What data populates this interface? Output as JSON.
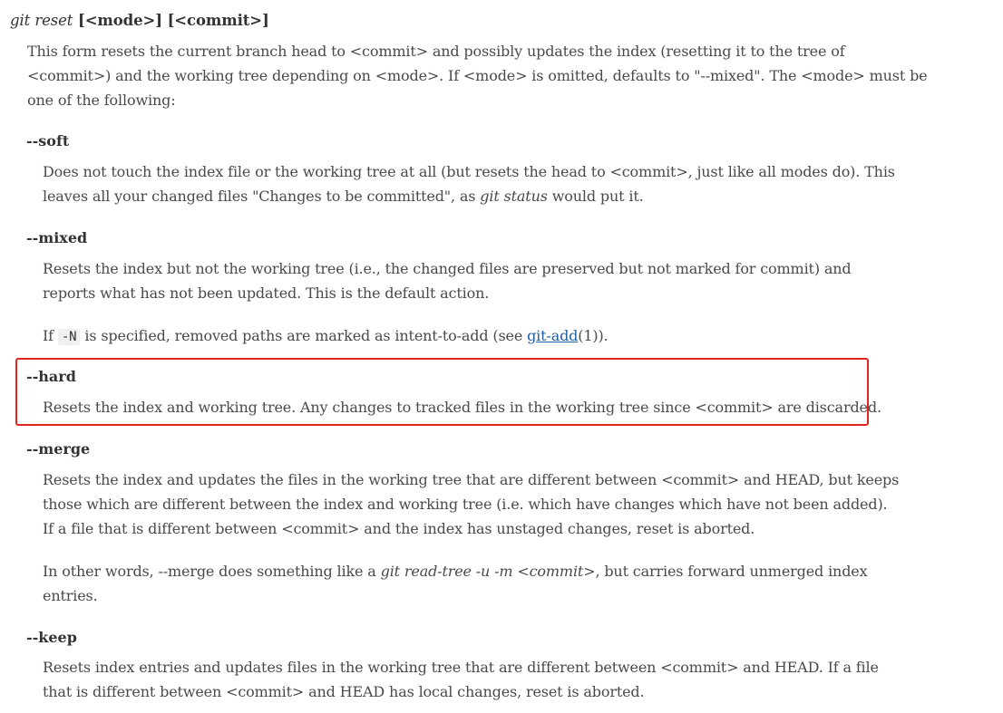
{
  "heading": {
    "command": "git reset",
    "args": " [<mode>] [<commit>]"
  },
  "intro": {
    "line1": "This form resets the current branch head to <commit> and possibly updates the index (resetting it to the tree of",
    "line2": "<commit>) and the working tree depending on <mode>. If <mode> is omitted, defaults to \"--mixed\". The <mode> must be",
    "line3": "one of the following:"
  },
  "modes": {
    "soft": {
      "term": "--soft",
      "line1": "Does not touch the index file or the working tree at all (but resets the head to <commit>, just like all modes do). This",
      "line2_before": "leaves all your changed files \"Changes to be committed\", as ",
      "line2_em": "git status",
      "line2_after": " would put it."
    },
    "mixed": {
      "term": "--mixed",
      "line1": "Resets the index but not the working tree (i.e., the changed files are preserved but not marked for commit) and",
      "line2": "reports what has not been updated. This is the default action.",
      "note_before": "If ",
      "note_code": "-N",
      "note_middle": " is specified, removed paths are marked as intent-to-add (see ",
      "note_link": "git-add",
      "note_after": "(1))."
    },
    "hard": {
      "term": "--hard",
      "line1": "Resets the index and working tree. Any changes to tracked files in the working tree since <commit> are discarded."
    },
    "merge": {
      "term": "--merge",
      "line1": "Resets the index and updates the files in the working tree that are different between <commit> and HEAD, but keeps",
      "line2": "those which are different between the index and working tree (i.e. which have changes which have not been added).",
      "line3": "If a file that is different between <commit> and the index has unstaged changes, reset is aborted.",
      "note_before": "In other words, --merge does something like a ",
      "note_em": "git read-tree -u -m <commit>",
      "note_after": ", but carries forward unmerged index",
      "note_line2": "entries."
    },
    "keep": {
      "term": "--keep",
      "line1": "Resets index entries and updates files in the working tree that are different between <commit> and HEAD. If a file",
      "line2": "that is different between <commit> and HEAD has local changes, reset is aborted."
    }
  },
  "colors": {
    "highlight_border": "#e0261e",
    "link": "#1f5fa6",
    "text": "#4a4a4a"
  }
}
